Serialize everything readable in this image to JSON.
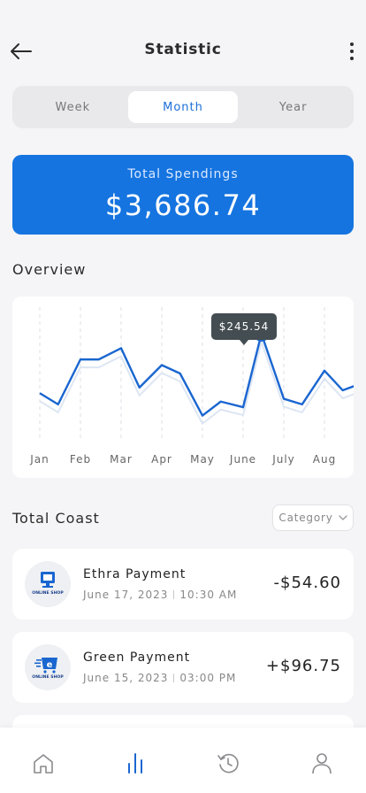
{
  "header": {
    "title": "Statistic",
    "back_icon": "arrow-left-icon",
    "more_icon": "more-vertical-icon"
  },
  "period_tabs": [
    {
      "label": "Week",
      "active": false
    },
    {
      "label": "Month",
      "active": true
    },
    {
      "label": "Year",
      "active": false
    }
  ],
  "summary": {
    "label": "Total Spendings",
    "amount": "$3,686.74",
    "color": "#1574e0"
  },
  "overview": {
    "title": "Overview",
    "tooltip": "$245.54"
  },
  "chart_data": {
    "type": "line",
    "title": "",
    "categories": [
      "Jan",
      "Feb",
      "Mar",
      "Apr",
      "May",
      "June",
      "July",
      "Aug"
    ],
    "series": [
      {
        "color": "#1a66d0",
        "x": [
          0,
          0.45,
          1,
          1.45,
          2,
          2.45,
          3,
          3.45,
          4,
          4.45,
          5,
          5.45,
          6,
          6.45,
          7,
          7.45,
          8,
          8.3
        ],
        "y": [
          140,
          120,
          200,
          200,
          220,
          150,
          190,
          175,
          100,
          125,
          115,
          245.54,
          130,
          120,
          180,
          145,
          160,
          175
        ]
      }
    ],
    "highlight": {
      "category": "June",
      "value": 245.54
    },
    "grid": "vertical-dashed",
    "y_range": [
      60,
      290
    ]
  },
  "transactions": {
    "title": "Total Coast",
    "filter_label": "Category",
    "items": [
      {
        "name": "Ethra Payment",
        "date": "June 17, 2023",
        "time": "10:30 AM",
        "amount": "-$54.60",
        "logo_text": "ONLINE SHOP"
      },
      {
        "name": "Green Payment",
        "date": "June 15, 2023",
        "time": "03:00 PM",
        "amount": "+$96.75",
        "logo_text": "ONLINE SHOP"
      }
    ]
  },
  "nav": [
    {
      "icon": "home-icon",
      "active": false
    },
    {
      "icon": "bar-chart-icon",
      "active": true
    },
    {
      "icon": "history-icon",
      "active": false
    },
    {
      "icon": "profile-icon",
      "active": false
    }
  ],
  "colors": {
    "accent": "#1574e0",
    "background": "#f5f5f7"
  }
}
